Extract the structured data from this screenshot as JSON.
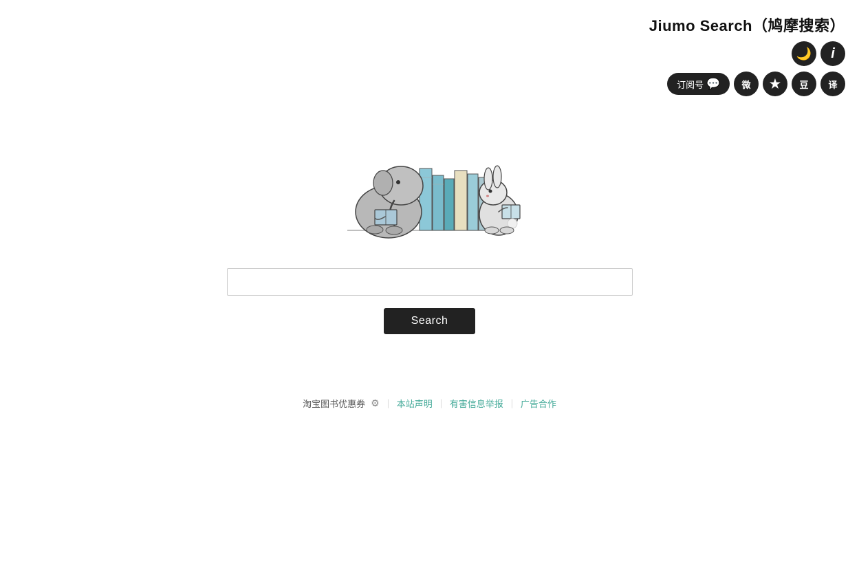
{
  "header": {
    "title": "Jiumo Search（鸠摩搜索）",
    "subscribe_label": "订阅号",
    "icons": {
      "moon": "🌙",
      "info": "ⓘ",
      "weibo": "微",
      "star": "★",
      "douban": "豆",
      "translate": "译"
    }
  },
  "search": {
    "placeholder": "",
    "button_label": "Search"
  },
  "footer": {
    "taobao_text": "淘宝图书优惠券",
    "site_statement": "本站声明",
    "report": "有害信息举报",
    "separator1": "｜",
    "separator2": "｜",
    "separator3": "｜",
    "cooperation": "广告合作"
  }
}
